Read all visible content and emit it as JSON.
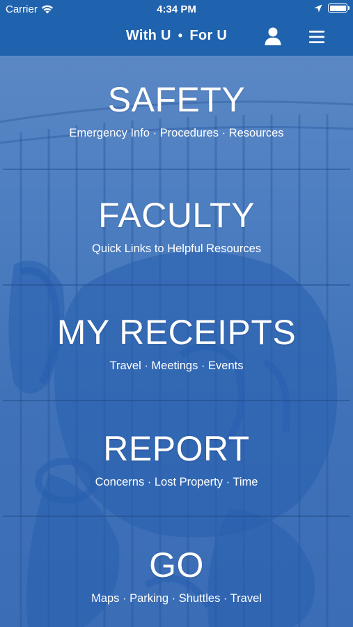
{
  "status_bar": {
    "carrier": "Carrier",
    "time": "4:34 PM"
  },
  "nav": {
    "title_left": "With U",
    "title_separator": "•",
    "title_right": "For U",
    "profile_icon": "person-icon",
    "menu_icon": "hamburger-menu-icon"
  },
  "tiles": [
    {
      "title": "SAFETY",
      "subtitle": "Emergency Info · Procedures · Resources"
    },
    {
      "title": "FACULTY",
      "subtitle": "Quick Links to Helpful Resources"
    },
    {
      "title": "MY RECEIPTS",
      "subtitle": "Travel · Meetings · Events"
    },
    {
      "title": "REPORT",
      "subtitle": "Concerns · Lost Property · Time"
    },
    {
      "title": "GO",
      "subtitle": "Maps · Parking · Shuttles · Travel"
    }
  ],
  "colors": {
    "brand_blue": "#1f63ae",
    "tile_overlay": "#4a7dc0"
  }
}
